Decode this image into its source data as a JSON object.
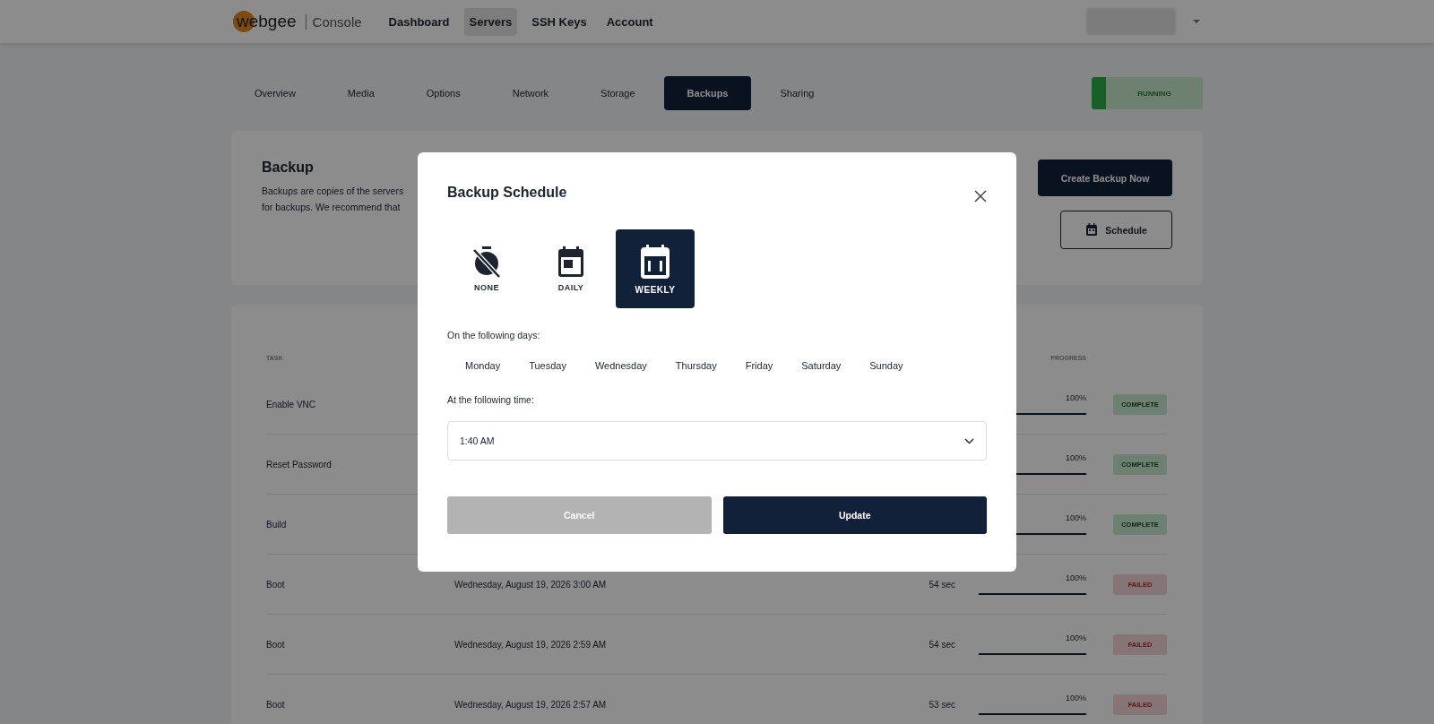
{
  "header": {
    "logo": "webgee",
    "product": "Console",
    "nav": [
      {
        "label": "Dashboard",
        "selected": false
      },
      {
        "label": "Servers",
        "selected": true
      },
      {
        "label": "SSH Keys",
        "selected": false
      },
      {
        "label": "Account",
        "selected": false
      }
    ]
  },
  "tabs": [
    {
      "label": "Overview",
      "selected": false
    },
    {
      "label": "Media",
      "selected": false
    },
    {
      "label": "Options",
      "selected": false
    },
    {
      "label": "Network",
      "selected": false
    },
    {
      "label": "Storage",
      "selected": false
    },
    {
      "label": "Backups",
      "selected": true
    },
    {
      "label": "Sharing",
      "selected": false
    }
  ],
  "server_status": "RUNNING",
  "backup_card": {
    "title": "Backup",
    "description_lines": [
      "Backups are copies of the servers",
      "for backups. We recommend that"
    ],
    "create_button": "Create Backup Now",
    "schedule_button": "Schedule"
  },
  "table": {
    "columns": [
      "TASK",
      "PROGRESS"
    ],
    "rows": [
      {
        "task": "Enable VNC",
        "progress": "100%",
        "level": 1,
        "status": "COMPLETE",
        "kind": "complete"
      },
      {
        "task": "Reset Password",
        "progress": "100%",
        "level": 1,
        "status": "COMPLETE",
        "kind": "complete"
      },
      {
        "task": "Build",
        "progress": "100%",
        "level": 1,
        "status": "COMPLETE",
        "kind": "complete"
      },
      {
        "task": "Boot",
        "date": "Wednesday, August 19, 2026 3:00 AM",
        "duration": "54 sec",
        "progress": "100%",
        "level": 1,
        "status": "FAILED",
        "kind": "failed"
      },
      {
        "task": "Boot",
        "date": "Wednesday, August 19, 2026 2:59 AM",
        "duration": "54 sec",
        "progress": "100%",
        "level": 1,
        "status": "FAILED",
        "kind": "failed"
      },
      {
        "task": "Boot",
        "date": "Wednesday, August 19, 2026 2:57 AM",
        "duration": "53 sec",
        "progress": "100%",
        "level": 1,
        "status": "FAILED",
        "kind": "failed"
      }
    ]
  },
  "modal": {
    "title": "Backup Schedule",
    "options": [
      {
        "label": "NONE",
        "kind": "none",
        "selected": false
      },
      {
        "label": "DAILY",
        "kind": "daily",
        "selected": false
      },
      {
        "label": "WEEKLY",
        "kind": "weekly",
        "selected": true
      }
    ],
    "days_label": "On the following days:",
    "days": [
      {
        "label": "Monday",
        "selected": false
      },
      {
        "label": "Tuesday",
        "selected": false
      },
      {
        "label": "Wednesday",
        "selected": false
      },
      {
        "label": "Thursday",
        "selected": false
      },
      {
        "label": "Friday",
        "selected": false
      },
      {
        "label": "Saturday",
        "selected": false
      },
      {
        "label": "Sunday",
        "selected": false
      }
    ],
    "time_label": "At the following time:",
    "time_value": "1:40 AM",
    "cancel": "Cancel",
    "update": "Update"
  }
}
